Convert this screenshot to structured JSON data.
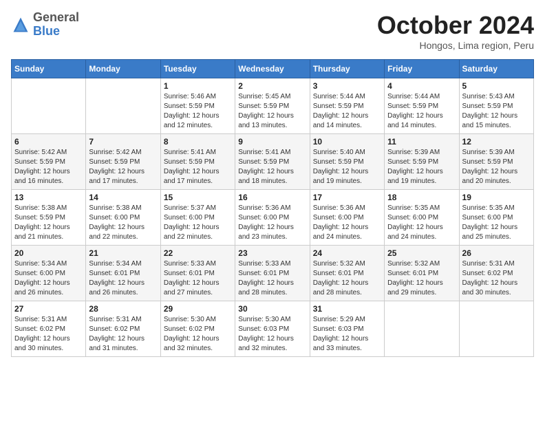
{
  "logo": {
    "general": "General",
    "blue": "Blue"
  },
  "header": {
    "month": "October 2024",
    "location": "Hongos, Lima region, Peru"
  },
  "days_of_week": [
    "Sunday",
    "Monday",
    "Tuesday",
    "Wednesday",
    "Thursday",
    "Friday",
    "Saturday"
  ],
  "weeks": [
    [
      {
        "day": "",
        "info": ""
      },
      {
        "day": "",
        "info": ""
      },
      {
        "day": "1",
        "info": "Sunrise: 5:46 AM\nSunset: 5:59 PM\nDaylight: 12 hours\nand 12 minutes."
      },
      {
        "day": "2",
        "info": "Sunrise: 5:45 AM\nSunset: 5:59 PM\nDaylight: 12 hours\nand 13 minutes."
      },
      {
        "day": "3",
        "info": "Sunrise: 5:44 AM\nSunset: 5:59 PM\nDaylight: 12 hours\nand 14 minutes."
      },
      {
        "day": "4",
        "info": "Sunrise: 5:44 AM\nSunset: 5:59 PM\nDaylight: 12 hours\nand 14 minutes."
      },
      {
        "day": "5",
        "info": "Sunrise: 5:43 AM\nSunset: 5:59 PM\nDaylight: 12 hours\nand 15 minutes."
      }
    ],
    [
      {
        "day": "6",
        "info": "Sunrise: 5:42 AM\nSunset: 5:59 PM\nDaylight: 12 hours\nand 16 minutes."
      },
      {
        "day": "7",
        "info": "Sunrise: 5:42 AM\nSunset: 5:59 PM\nDaylight: 12 hours\nand 17 minutes."
      },
      {
        "day": "8",
        "info": "Sunrise: 5:41 AM\nSunset: 5:59 PM\nDaylight: 12 hours\nand 17 minutes."
      },
      {
        "day": "9",
        "info": "Sunrise: 5:41 AM\nSunset: 5:59 PM\nDaylight: 12 hours\nand 18 minutes."
      },
      {
        "day": "10",
        "info": "Sunrise: 5:40 AM\nSunset: 5:59 PM\nDaylight: 12 hours\nand 19 minutes."
      },
      {
        "day": "11",
        "info": "Sunrise: 5:39 AM\nSunset: 5:59 PM\nDaylight: 12 hours\nand 19 minutes."
      },
      {
        "day": "12",
        "info": "Sunrise: 5:39 AM\nSunset: 5:59 PM\nDaylight: 12 hours\nand 20 minutes."
      }
    ],
    [
      {
        "day": "13",
        "info": "Sunrise: 5:38 AM\nSunset: 5:59 PM\nDaylight: 12 hours\nand 21 minutes."
      },
      {
        "day": "14",
        "info": "Sunrise: 5:38 AM\nSunset: 6:00 PM\nDaylight: 12 hours\nand 22 minutes."
      },
      {
        "day": "15",
        "info": "Sunrise: 5:37 AM\nSunset: 6:00 PM\nDaylight: 12 hours\nand 22 minutes."
      },
      {
        "day": "16",
        "info": "Sunrise: 5:36 AM\nSunset: 6:00 PM\nDaylight: 12 hours\nand 23 minutes."
      },
      {
        "day": "17",
        "info": "Sunrise: 5:36 AM\nSunset: 6:00 PM\nDaylight: 12 hours\nand 24 minutes."
      },
      {
        "day": "18",
        "info": "Sunrise: 5:35 AM\nSunset: 6:00 PM\nDaylight: 12 hours\nand 24 minutes."
      },
      {
        "day": "19",
        "info": "Sunrise: 5:35 AM\nSunset: 6:00 PM\nDaylight: 12 hours\nand 25 minutes."
      }
    ],
    [
      {
        "day": "20",
        "info": "Sunrise: 5:34 AM\nSunset: 6:00 PM\nDaylight: 12 hours\nand 26 minutes."
      },
      {
        "day": "21",
        "info": "Sunrise: 5:34 AM\nSunset: 6:01 PM\nDaylight: 12 hours\nand 26 minutes."
      },
      {
        "day": "22",
        "info": "Sunrise: 5:33 AM\nSunset: 6:01 PM\nDaylight: 12 hours\nand 27 minutes."
      },
      {
        "day": "23",
        "info": "Sunrise: 5:33 AM\nSunset: 6:01 PM\nDaylight: 12 hours\nand 28 minutes."
      },
      {
        "day": "24",
        "info": "Sunrise: 5:32 AM\nSunset: 6:01 PM\nDaylight: 12 hours\nand 28 minutes."
      },
      {
        "day": "25",
        "info": "Sunrise: 5:32 AM\nSunset: 6:01 PM\nDaylight: 12 hours\nand 29 minutes."
      },
      {
        "day": "26",
        "info": "Sunrise: 5:31 AM\nSunset: 6:02 PM\nDaylight: 12 hours\nand 30 minutes."
      }
    ],
    [
      {
        "day": "27",
        "info": "Sunrise: 5:31 AM\nSunset: 6:02 PM\nDaylight: 12 hours\nand 30 minutes."
      },
      {
        "day": "28",
        "info": "Sunrise: 5:31 AM\nSunset: 6:02 PM\nDaylight: 12 hours\nand 31 minutes."
      },
      {
        "day": "29",
        "info": "Sunrise: 5:30 AM\nSunset: 6:02 PM\nDaylight: 12 hours\nand 32 minutes."
      },
      {
        "day": "30",
        "info": "Sunrise: 5:30 AM\nSunset: 6:03 PM\nDaylight: 12 hours\nand 32 minutes."
      },
      {
        "day": "31",
        "info": "Sunrise: 5:29 AM\nSunset: 6:03 PM\nDaylight: 12 hours\nand 33 minutes."
      },
      {
        "day": "",
        "info": ""
      },
      {
        "day": "",
        "info": ""
      }
    ]
  ]
}
